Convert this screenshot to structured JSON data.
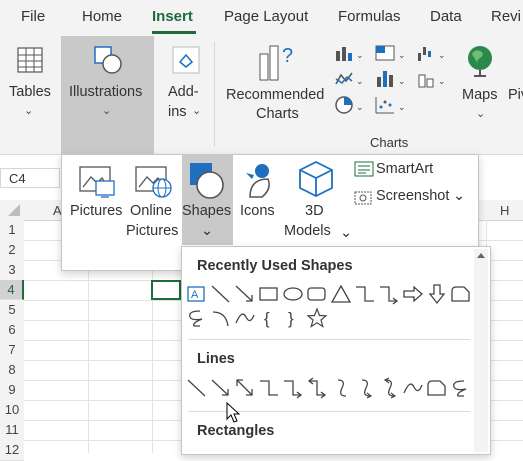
{
  "tabs": [
    "File",
    "Home",
    "Insert",
    "Page Layout",
    "Formulas",
    "Data",
    "Revi"
  ],
  "ribbon": {
    "tables_label": "Tables",
    "illustrations_label": "Illustrations",
    "addins_label_1": "Add-",
    "addins_label_2": "ins",
    "recommended_label_1": "Recommended",
    "recommended_label_2": "Charts",
    "maps_label": "Maps",
    "pivot_label": "Pivo",
    "charts_group_label": "Charts"
  },
  "namebox": "C4",
  "columns": [
    "A",
    "H"
  ],
  "rows": [
    "1",
    "2",
    "3",
    "4",
    "5",
    "6",
    "7",
    "8",
    "9",
    "10",
    "11",
    "12"
  ],
  "illustrations_menu": {
    "pictures": "Pictures",
    "online_pictures_1": "Online",
    "online_pictures_2": "Pictures",
    "shapes": "Shapes",
    "icons": "Icons",
    "models_1": "3D",
    "models_2": "Models",
    "smartart": "SmartArt",
    "screenshot": "Screenshot"
  },
  "shapes_gallery": {
    "recent_title": "Recently Used Shapes",
    "lines_title": "Lines",
    "rectangles_title": "Rectangles"
  },
  "colors": {
    "accent": "#1e6b3c",
    "icon_blue": "#1f6fbf"
  }
}
